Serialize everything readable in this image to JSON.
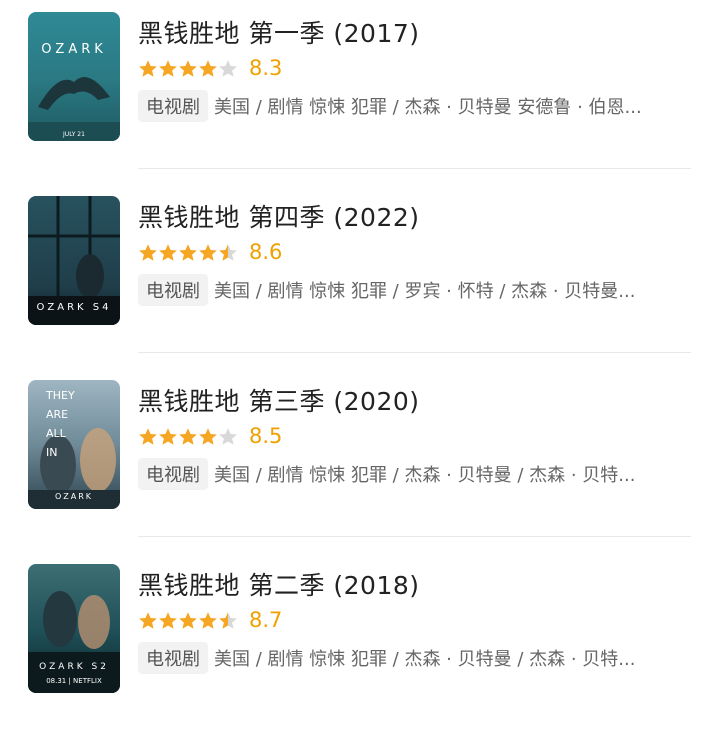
{
  "items": [
    {
      "title": "黑钱胜地 第一季 (2017)",
      "rating": 8.3,
      "score_text": "8.3",
      "stars": [
        1,
        1,
        1,
        1,
        0
      ],
      "tag": "电视剧",
      "info": "美国 / 剧情 惊悚 犯罪 / 杰森 · 贝特曼 安德鲁 · 伯恩...",
      "poster": {
        "brand": "OZARK",
        "accent": "#2b7b86",
        "bottom": "JULY 21"
      }
    },
    {
      "title": "黑钱胜地 第四季 (2022)",
      "rating": 8.6,
      "score_text": "8.6",
      "stars": [
        1,
        1,
        1,
        1,
        0.5
      ],
      "tag": "电视剧",
      "info": "美国 / 剧情 惊悚 犯罪 / 罗宾 · 怀特 / 杰森 · 贝特曼...",
      "poster": {
        "brand": "OZARK S4",
        "accent": "#1f3e4a",
        "bottom": ""
      }
    },
    {
      "title": "黑钱胜地 第三季 (2020)",
      "rating": 8.5,
      "score_text": "8.5",
      "stars": [
        1,
        1,
        1,
        1,
        0
      ],
      "tag": "电视剧",
      "info": "美国 / 剧情 惊悚 犯罪 / 杰森 · 贝特曼 / 杰森 · 贝特...",
      "poster": {
        "brand": "OZARK",
        "accent": "#5a7a8a",
        "bottom": "",
        "words": [
          "THEY",
          "ARE",
          "ALL",
          "IN"
        ]
      }
    },
    {
      "title": "黑钱胜地 第二季 (2018)",
      "rating": 8.7,
      "score_text": "8.7",
      "stars": [
        1,
        1,
        1,
        1,
        0.5
      ],
      "tag": "电视剧",
      "info": "美国 / 剧情 惊悚 犯罪 / 杰森 · 贝特曼 / 杰森 · 贝特...",
      "poster": {
        "brand": "OZARK S2",
        "accent": "#1d4d55",
        "bottom": "08.31 | NETFLIX"
      }
    }
  ],
  "colors": {
    "star_on": "#f5a623",
    "star_off": "#d8d8d8",
    "score": "#f0a000"
  }
}
